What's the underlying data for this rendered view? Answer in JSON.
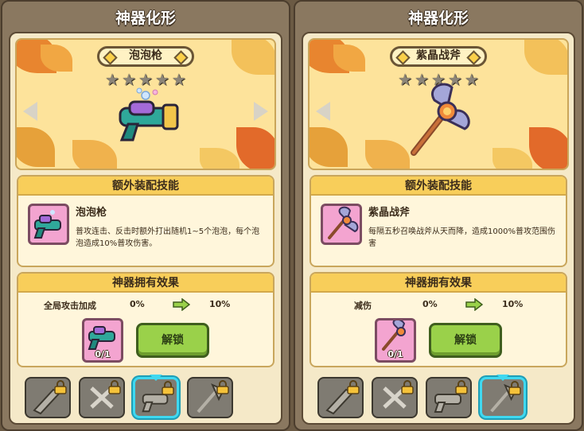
{
  "panels": [
    {
      "title": "神器化形",
      "weapon_name": "泡泡枪",
      "stars_filled": 0,
      "stars_total": 5,
      "skill_header": "额外装配技能",
      "skill_name": "泡泡枪",
      "skill_desc": "普攻连击、反击时额外打出随机1~5个泡泡，每个泡泡造成10%普攻伤害。",
      "effect_header": "神器拥有效果",
      "effect_label": "全局攻击加成",
      "effect_from": "0%",
      "effect_to": "10%",
      "icon_count": "0/1",
      "unlock_label": "解锁",
      "weapon_icon": "bubble-gun-icon",
      "selected_slot": 2
    },
    {
      "title": "神器化形",
      "weapon_name": "紫晶战斧",
      "stars_filled": 0,
      "stars_total": 5,
      "skill_header": "额外装配技能",
      "skill_name": "紫晶战斧",
      "skill_desc": "每隔五秒召唤战斧从天而降，造成1000%普攻范围伤害",
      "effect_header": "神器拥有效果",
      "effect_label": "减伤",
      "effect_from": "0%",
      "effect_to": "10%",
      "icon_count": "0/1",
      "unlock_label": "解锁",
      "weapon_icon": "amethyst-axe-icon",
      "selected_slot": 3
    }
  ],
  "colors": {
    "accent_gold": "#f8ce5a",
    "unlock_green": "#9ad14a",
    "selected_cyan": "#3fd8f0"
  }
}
